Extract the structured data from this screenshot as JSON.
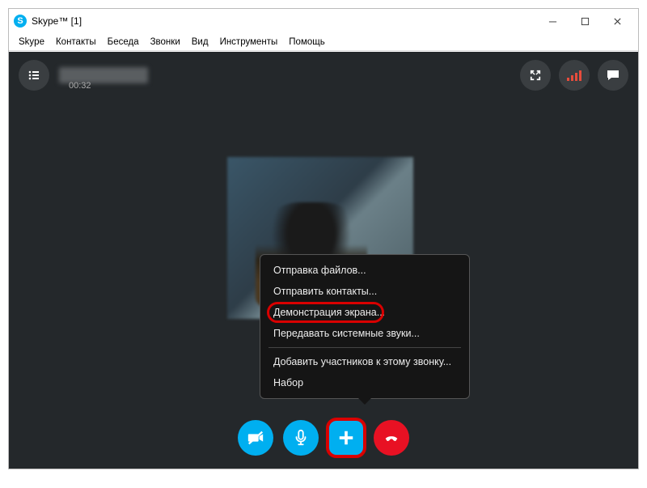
{
  "window": {
    "title": "Skype™ [1]",
    "logo_letter": "S"
  },
  "menu": {
    "items": [
      "Skype",
      "Контакты",
      "Беседа",
      "Звонки",
      "Вид",
      "Инструменты",
      "Помощь"
    ]
  },
  "call": {
    "timer": "00:32"
  },
  "popup": {
    "items": [
      {
        "label": "Отправка файлов...",
        "hl": false
      },
      {
        "label": "Отправить контакты...",
        "hl": false
      },
      {
        "label": "Демонстрация экрана...",
        "hl": true
      },
      {
        "label": "Передавать системные звуки...",
        "hl": false
      },
      {
        "sep": true
      },
      {
        "label": "Добавить участников к этому звонку...",
        "hl": false
      },
      {
        "label": "Набор",
        "hl": false
      }
    ]
  },
  "icons": {
    "camera_off": "camera-off-icon",
    "mic": "mic-icon",
    "plus": "plus-icon",
    "hangup": "hangup-icon",
    "fullscreen": "fullscreen-icon",
    "signal": "signal-icon",
    "chat": "chat-icon",
    "list": "list-icon"
  }
}
